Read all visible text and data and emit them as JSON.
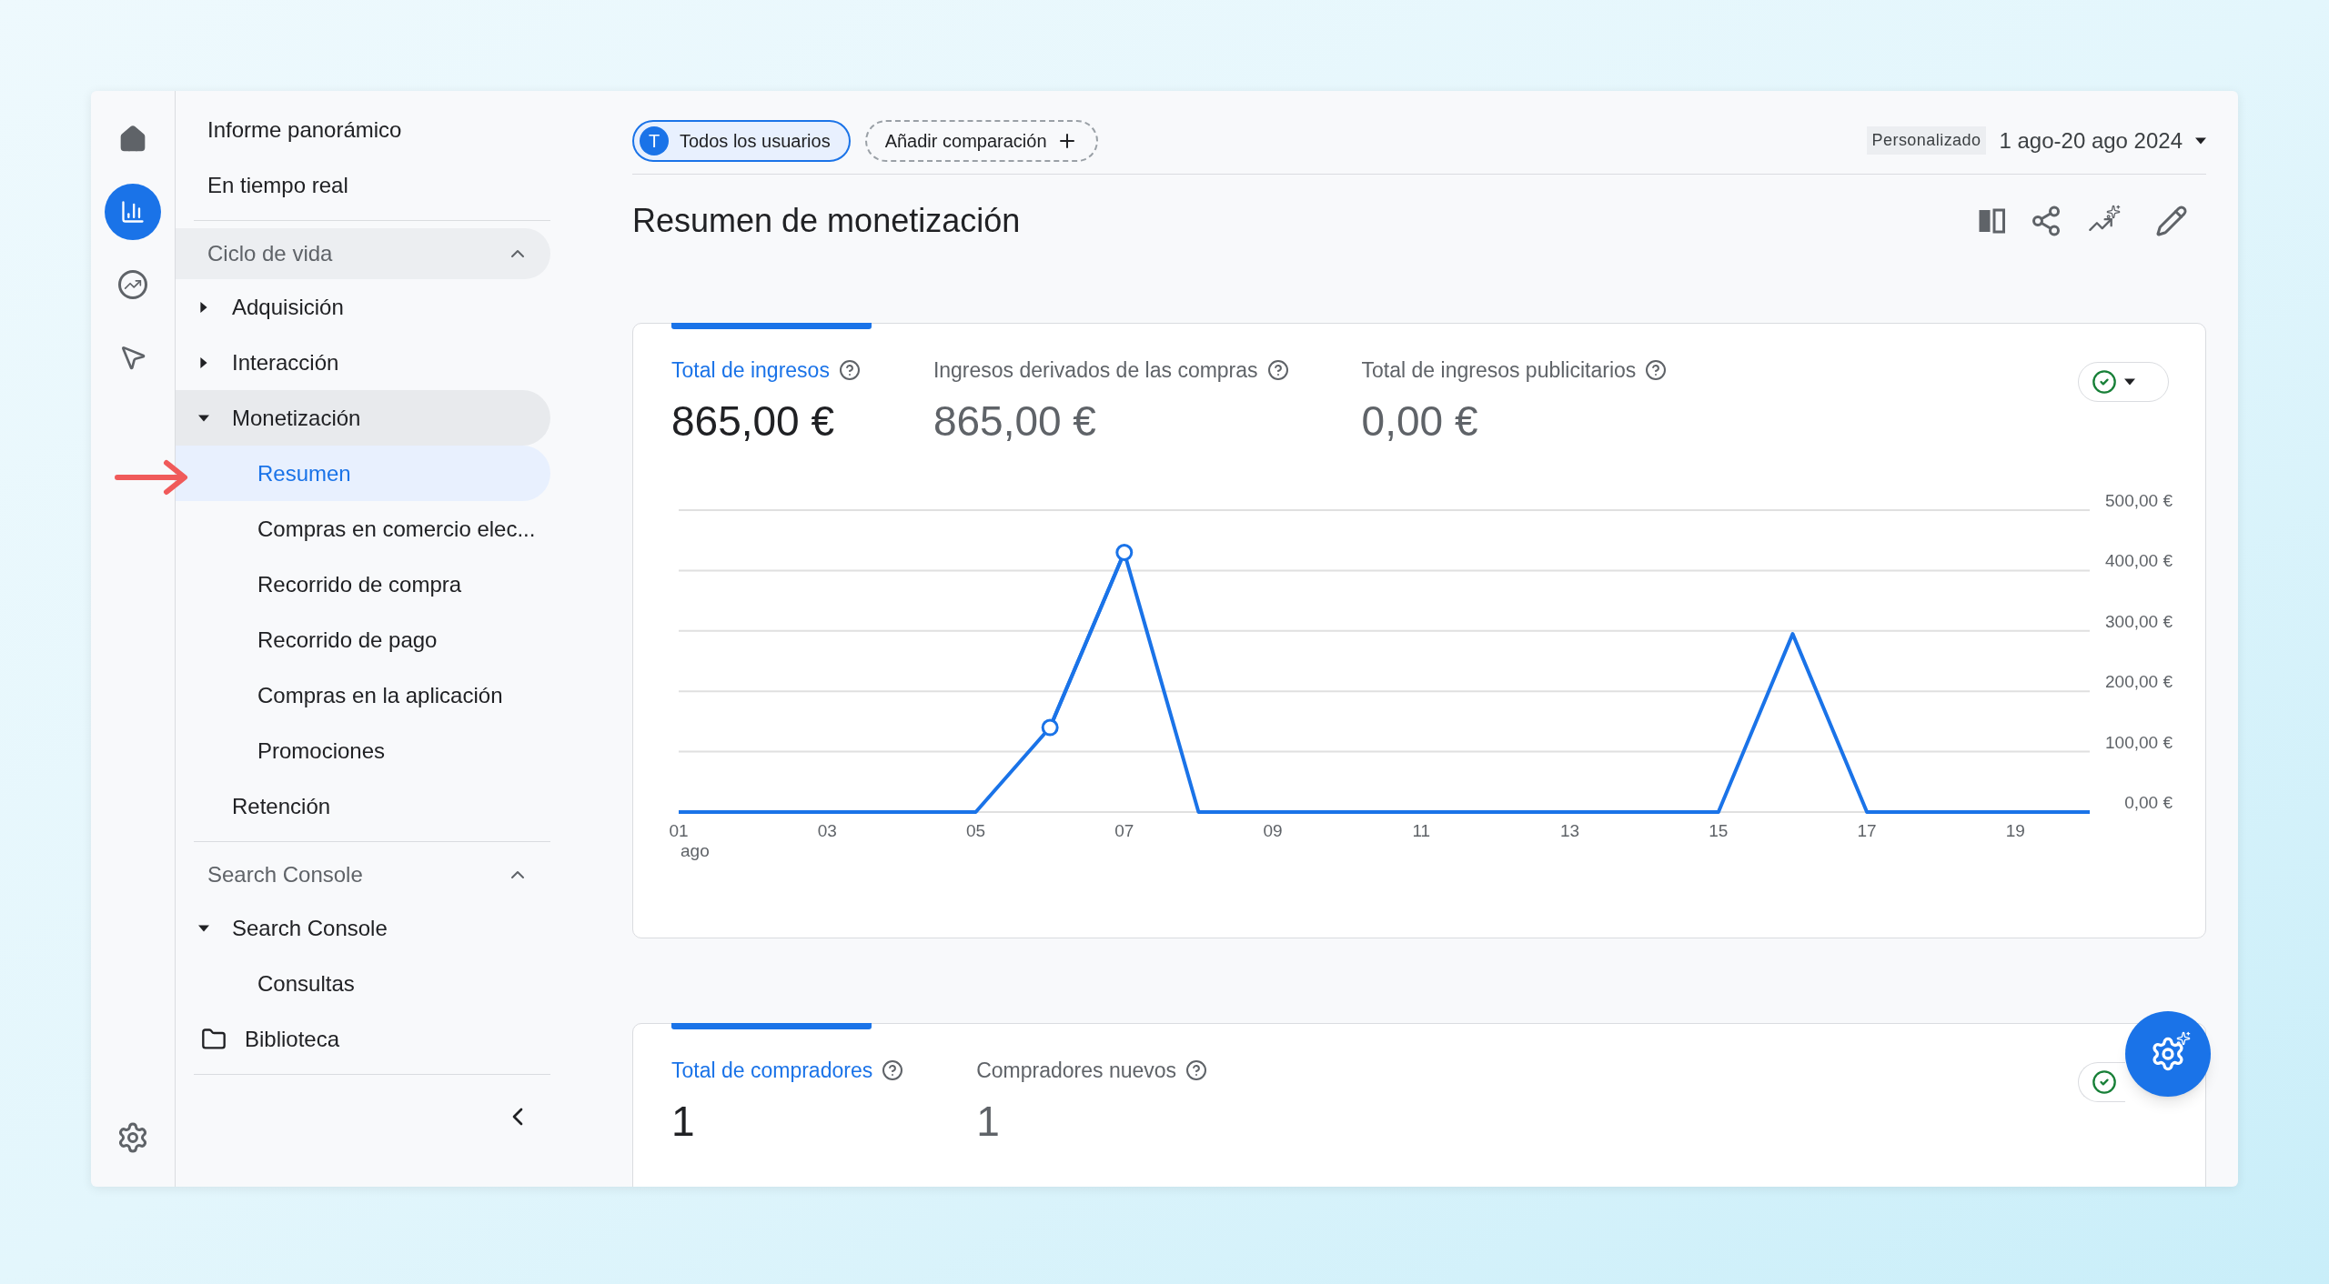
{
  "rail": {
    "items": [
      {
        "kind": "home",
        "selected": false
      },
      {
        "kind": "reports",
        "selected": true
      },
      {
        "kind": "explore",
        "selected": false
      },
      {
        "kind": "advertising",
        "selected": false
      }
    ]
  },
  "nav": {
    "top_items": [
      {
        "label": "Informe panorámico"
      },
      {
        "label": "En tiempo real"
      }
    ],
    "sections": [
      {
        "title": "Ciclo de vida",
        "expanded": true,
        "items": [
          {
            "label": "Adquisición",
            "kind": "group",
            "expanded": false,
            "selected": false
          },
          {
            "label": "Interacción",
            "kind": "group",
            "expanded": false,
            "selected": false
          },
          {
            "label": "Monetización",
            "kind": "group",
            "expanded": true,
            "selected": false,
            "children": [
              {
                "label": "Resumen",
                "selected": true
              },
              {
                "label": "Compras en comercio elec...",
                "selected": false
              },
              {
                "label": "Recorrido de compra",
                "selected": false
              },
              {
                "label": "Recorrido de pago",
                "selected": false
              },
              {
                "label": "Compras en la aplicación",
                "selected": false
              },
              {
                "label": "Promociones",
                "selected": false
              }
            ]
          },
          {
            "label": "Retención",
            "kind": "leaf",
            "selected": false
          }
        ]
      },
      {
        "title": "Search Console",
        "expanded": true,
        "items": [
          {
            "label": "Search Console",
            "kind": "group",
            "expanded": true,
            "selected": false,
            "children": [
              {
                "label": "Consultas",
                "selected": false
              }
            ]
          }
        ]
      }
    ],
    "bottom_items": [
      {
        "label": "Biblioteca",
        "kind": "folder"
      }
    ]
  },
  "top_bar": {
    "segment": {
      "initial": "T",
      "label": "Todos los usuarios"
    },
    "compare_button": "Añadir comparación",
    "date_type": "Personalizado",
    "date_range": "1 ago-20 ago 2024"
  },
  "title": "Resumen de monetización",
  "cards": [
    {
      "metrics": [
        {
          "label": "Total de ingresos",
          "value": "865,00 €",
          "selected": true
        },
        {
          "label": "Ingresos derivados de las compras",
          "value": "865,00 €",
          "selected": false
        },
        {
          "label": "Total de ingresos publicitarios",
          "value": "0,00 €",
          "selected": false
        }
      ],
      "month_label": "ago",
      "chart_data": {
        "type": "line",
        "x": [
          1,
          2,
          3,
          4,
          5,
          6,
          7,
          8,
          9,
          10,
          11,
          12,
          13,
          14,
          15,
          16,
          17,
          18,
          19,
          20
        ],
        "xlim": [
          1,
          20
        ],
        "grid": true,
        "series": [
          {
            "color": "#1a73e8",
            "values": [
              0,
              0,
              0,
              0,
              0,
              140,
              430,
              0,
              0,
              0,
              0,
              0,
              0,
              0,
              0,
              295,
              0,
              0,
              0,
              0
            ]
          },
          {
            "color": "#1a73e8",
            "values": [
              null,
              null,
              null,
              null,
              null,
              140,
              430,
              null,
              null,
              null,
              null,
              null,
              null,
              null,
              null,
              null,
              null,
              null,
              null,
              null
            ]
          }
        ],
        "xticks": [
          {
            "value": 1,
            "label": "01"
          },
          {
            "value": 3,
            "label": "03"
          },
          {
            "value": 5,
            "label": "05"
          },
          {
            "value": 7,
            "label": "07"
          },
          {
            "value": 9,
            "label": "09"
          },
          {
            "value": 11,
            "label": "11"
          },
          {
            "value": 13,
            "label": "13"
          },
          {
            "value": 15,
            "label": "15"
          },
          {
            "value": 17,
            "label": "17"
          },
          {
            "value": 19,
            "label": "19"
          }
        ],
        "ylim": [
          0,
          500
        ],
        "yticks": [
          {
            "value": 0,
            "label": "0,00 €"
          },
          {
            "value": 100,
            "label": "100,00 €"
          },
          {
            "value": 200,
            "label": "200,00 €"
          },
          {
            "value": 300,
            "label": "300,00 €"
          },
          {
            "value": 400,
            "label": "400,00 €"
          },
          {
            "value": 500,
            "label": "500,00 €"
          }
        ]
      }
    },
    {
      "metrics": [
        {
          "label": "Total de compradores",
          "value": "1",
          "selected": true
        },
        {
          "label": "Compradores nuevos",
          "value": "1",
          "selected": false
        }
      ]
    }
  ]
}
